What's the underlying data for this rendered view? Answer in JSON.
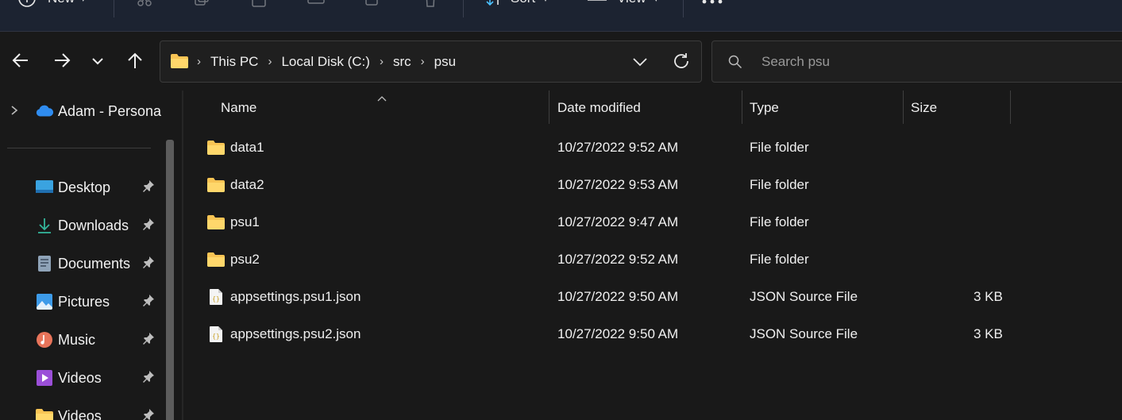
{
  "toolbar": {
    "new_label": "New",
    "sort_label": "Sort",
    "view_label": "View"
  },
  "address": {
    "crumbs": [
      "This PC",
      "Local Disk (C:)",
      "src",
      "psu"
    ]
  },
  "search": {
    "placeholder": "Search psu"
  },
  "sidebar": {
    "account": "Adam - Persona",
    "items": [
      {
        "label": "Desktop",
        "icon": "desktop-icon"
      },
      {
        "label": "Downloads",
        "icon": "downloads-icon"
      },
      {
        "label": "Documents",
        "icon": "documents-icon"
      },
      {
        "label": "Pictures",
        "icon": "pictures-icon"
      },
      {
        "label": "Music",
        "icon": "music-icon"
      },
      {
        "label": "Videos",
        "icon": "videos-icon"
      },
      {
        "label": "Videos",
        "icon": "folder-icon"
      }
    ]
  },
  "columns": {
    "name": "Name",
    "date": "Date modified",
    "type": "Type",
    "size": "Size"
  },
  "files": [
    {
      "name": "data1",
      "date": "10/27/2022 9:52 AM",
      "type": "File folder",
      "size": "",
      "icon": "folder-icon"
    },
    {
      "name": "data2",
      "date": "10/27/2022 9:53 AM",
      "type": "File folder",
      "size": "",
      "icon": "folder-icon"
    },
    {
      "name": "psu1",
      "date": "10/27/2022 9:47 AM",
      "type": "File folder",
      "size": "",
      "icon": "folder-icon"
    },
    {
      "name": "psu2",
      "date": "10/27/2022 9:52 AM",
      "type": "File folder",
      "size": "",
      "icon": "folder-icon"
    },
    {
      "name": "appsettings.psu1.json",
      "date": "10/27/2022 9:50 AM",
      "type": "JSON Source File",
      "size": "3 KB",
      "icon": "json-file-icon"
    },
    {
      "name": "appsettings.psu2.json",
      "date": "10/27/2022 9:50 AM",
      "type": "JSON Source File",
      "size": "3 KB",
      "icon": "json-file-icon"
    }
  ],
  "colors": {
    "background": "#191919",
    "toolbar": "#1c2331",
    "folder": "#f8c454",
    "accent": "#4cc2ff"
  }
}
